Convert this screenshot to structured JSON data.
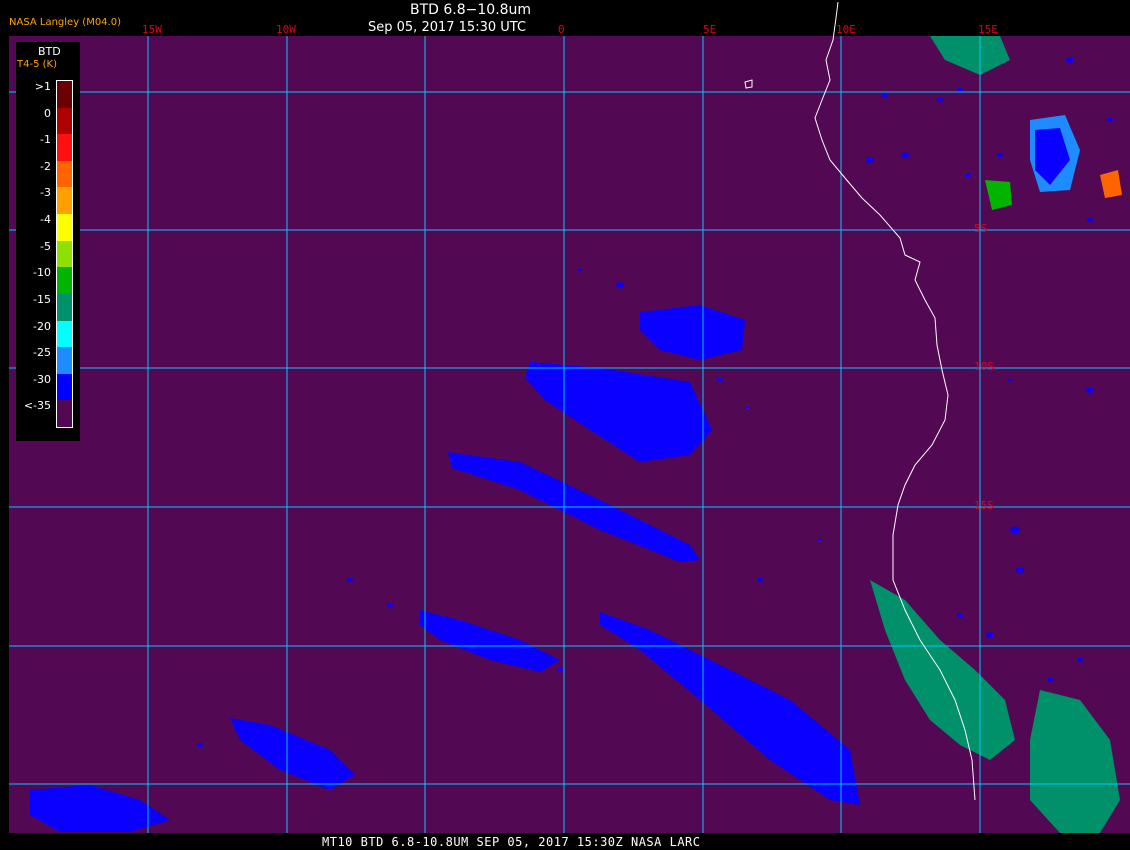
{
  "title": "BTD 6.8−10.8um",
  "datetime": "Sep 05, 2017 15:30 UTC",
  "producer": "NASA Langley (M04.0)",
  "footer": "MT10  BTD 6.8-10.8UM   SEP 05, 2017 15:30Z   NASA LARC",
  "colors": {
    "background": "#530853",
    "grid": "#00c8ff",
    "coast": "#ffffff",
    "grid_label": "#e0001a"
  },
  "legend": {
    "title": "BTD",
    "subtitle": "T4-5 (K)",
    "bins": [
      {
        "label": ">1",
        "color": "#6a0000"
      },
      {
        "label": "0",
        "color": "#b00000"
      },
      {
        "label": "-1",
        "color": "#ff1010"
      },
      {
        "label": "-2",
        "color": "#ff6400"
      },
      {
        "label": "-3",
        "color": "#ffa000"
      },
      {
        "label": "-4",
        "color": "#ffff00"
      },
      {
        "label": "-5",
        "color": "#8ee000"
      },
      {
        "label": "-10",
        "color": "#00b400"
      },
      {
        "label": "-15",
        "color": "#00906a"
      },
      {
        "label": "-20",
        "color": "#00ffff"
      },
      {
        "label": "-25",
        "color": "#1e8cff"
      },
      {
        "label": "-30",
        "color": "#0000ff"
      },
      {
        "label": "<-35",
        "color": "#530853"
      }
    ]
  },
  "grid": {
    "longitudes": [
      "15W",
      "10W",
      "0",
      "5E",
      "10E",
      "15E"
    ],
    "latitudes": [
      "5S",
      "10S",
      "15S"
    ]
  }
}
